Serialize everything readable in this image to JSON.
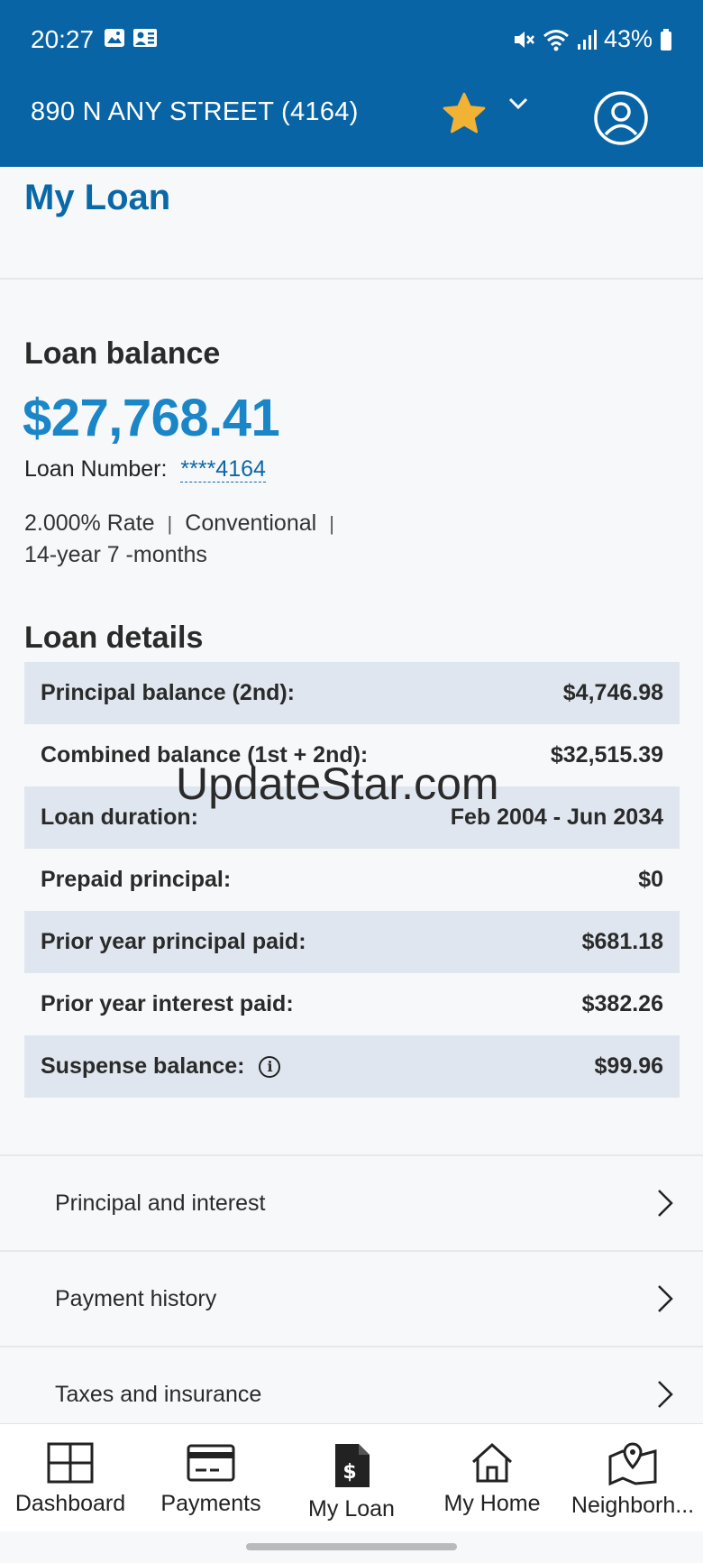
{
  "status_bar": {
    "time": "20:27",
    "battery": "43%",
    "icons": [
      "gallery-icon",
      "contact-card-icon",
      "mute-icon",
      "wifi-icon",
      "signal-icon",
      "battery-icon"
    ]
  },
  "app_bar": {
    "address": "890 N ANY STREET (4164)",
    "icons": [
      "star-icon",
      "chevron-down-icon",
      "profile-icon"
    ],
    "star_color": "#f2b233",
    "bg_color": "#0864a4"
  },
  "page": {
    "title": "My Loan"
  },
  "balance": {
    "label": "Loan balance",
    "amount": "$27,768.41",
    "loan_number_label": "Loan Number:",
    "loan_number_value": "****4164",
    "rate": "2.000% Rate",
    "type": "Conventional",
    "term": "14-year 7 -months",
    "separator": "|"
  },
  "details": {
    "title": "Loan details",
    "rows": [
      {
        "label": "Principal balance (2nd):",
        "value": "$4,746.98"
      },
      {
        "label": "Combined balance (1st + 2nd):",
        "value": "$32,515.39"
      },
      {
        "label": "Loan duration:",
        "value": "Feb 2004 - Jun 2034"
      },
      {
        "label": "Prepaid principal:",
        "value": "$0"
      },
      {
        "label": "Prior year principal paid:",
        "value": "$681.18"
      },
      {
        "label": "Prior year interest paid:",
        "value": "$382.26"
      },
      {
        "label": "Suspense balance:",
        "value": "$99.96",
        "info": "i"
      }
    ]
  },
  "links": [
    {
      "label": "Principal and interest"
    },
    {
      "label": "Payment history"
    },
    {
      "label": "Taxes and insurance"
    }
  ],
  "watermark": "UpdateStar.com",
  "bottom_nav": [
    {
      "label": "Dashboard",
      "icon": "dashboard-icon"
    },
    {
      "label": "Payments",
      "icon": "credit-card-icon"
    },
    {
      "label": "My Loan",
      "icon": "loan-document-icon"
    },
    {
      "label": "My Home",
      "icon": "house-icon"
    },
    {
      "label": "Neighborh...",
      "icon": "map-pin-icon"
    }
  ]
}
